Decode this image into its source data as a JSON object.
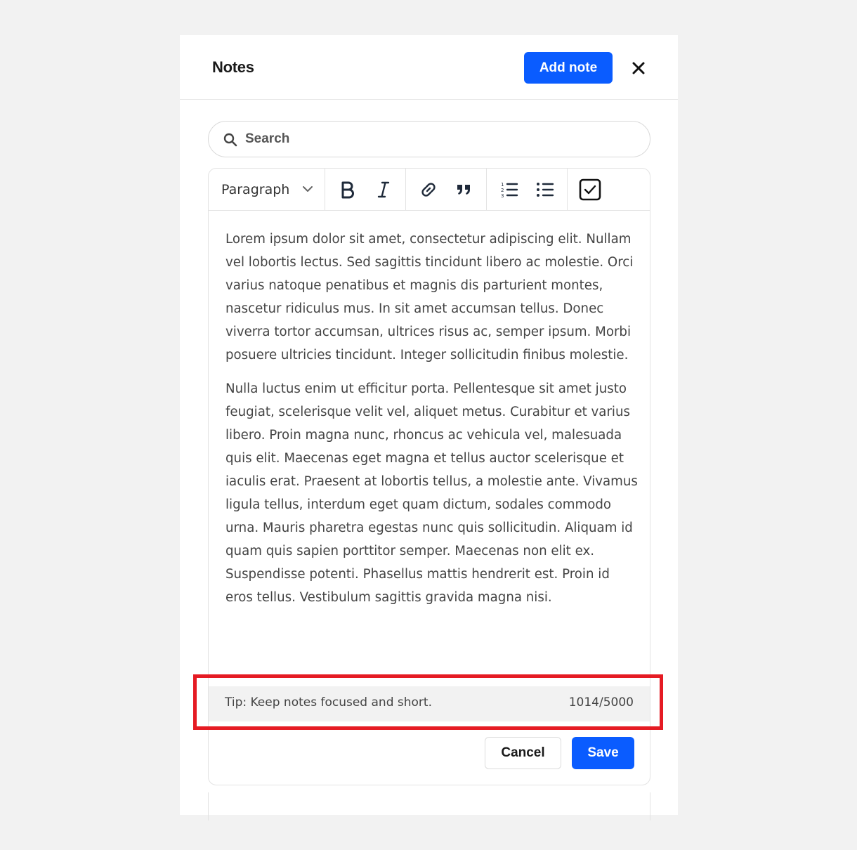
{
  "header": {
    "title": "Notes",
    "add_button": "Add note",
    "close_icon": "close-icon"
  },
  "search": {
    "placeholder": "Search",
    "icon": "search-icon"
  },
  "toolbar": {
    "block_format": "Paragraph",
    "icons": [
      "bold-icon",
      "italic-icon",
      "link-icon",
      "quote-icon",
      "numbered-list-icon",
      "bulleted-list-icon",
      "checklist-icon"
    ]
  },
  "editor": {
    "paragraphs": [
      "Lorem ipsum dolor sit amet, consectetur adipiscing elit. Nullam vel lobortis lectus. Sed sagittis tincidunt libero ac molestie. Orci varius natoque penatibus et magnis dis parturient montes, nascetur ridiculus mus. In sit amet accumsan tellus. Donec viverra tortor accumsan, ultrices risus ac, semper ipsum. Morbi posuere ultricies tincidunt. Integer sollicitudin finibus molestie.",
      "Nulla luctus enim ut efficitur porta. Pellentesque sit amet justo feugiat, scelerisque velit vel, aliquet metus. Curabitur et varius libero. Proin magna nunc, rhoncus ac vehicula vel, malesuada quis elit. Maecenas eget magna et tellus auctor scelerisque et iaculis erat. Praesent at lobortis tellus, a molestie ante. Vivamus ligula tellus, interdum eget quam dictum, sodales commodo urna. Mauris pharetra egestas nunc quis sollicitudin. Aliquam id quam quis sapien porttitor semper. Maecenas non elit ex. Suspendisse potenti. Phasellus mattis hendrerit est. Proin id eros tellus. Vestibulum sagittis gravida magna nisi."
    ],
    "tip": "Tip: Keep notes focused and short.",
    "char_count": "1014/5000"
  },
  "actions": {
    "cancel": "Cancel",
    "save": "Save"
  },
  "colors": {
    "accent": "#0a5cff",
    "highlight": "#e51b23"
  }
}
